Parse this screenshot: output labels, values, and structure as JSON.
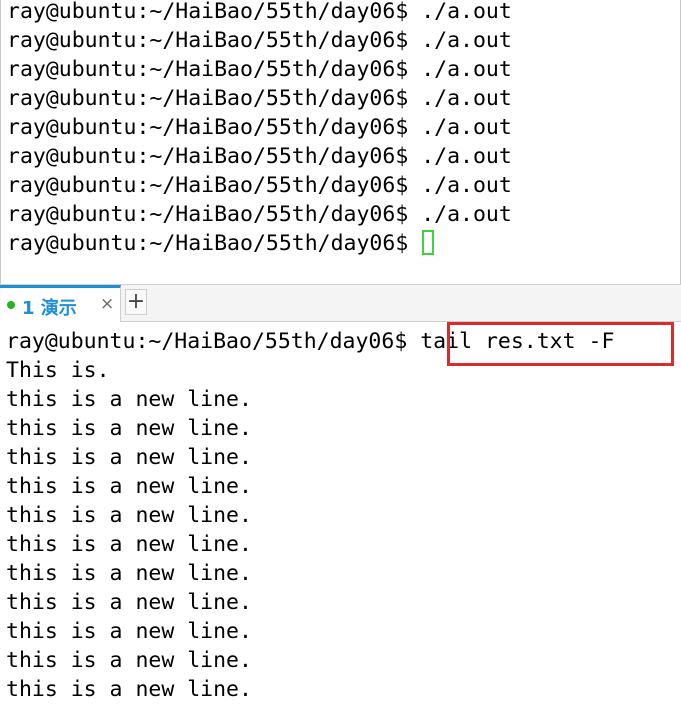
{
  "top_pane": {
    "lines": [
      "ray@ubuntu:~/HaiBao/55th/day06$ ./a.out",
      "ray@ubuntu:~/HaiBao/55th/day06$ ./a.out",
      "ray@ubuntu:~/HaiBao/55th/day06$ ./a.out",
      "ray@ubuntu:~/HaiBao/55th/day06$ ./a.out",
      "ray@ubuntu:~/HaiBao/55th/day06$ ./a.out",
      "ray@ubuntu:~/HaiBao/55th/day06$ ./a.out",
      "ray@ubuntu:~/HaiBao/55th/day06$ ./a.out",
      "ray@ubuntu:~/HaiBao/55th/day06$ ./a.out"
    ],
    "prompt": "ray@ubuntu:~/HaiBao/55th/day06$"
  },
  "tabbar": {
    "tab_label": "1 演示",
    "close_glyph": "×",
    "add_glyph": "+",
    "status_color": "#1fb81f",
    "accent_color": "#1f8fd6"
  },
  "bottom_pane": {
    "prompt": "ray@ubuntu:~/HaiBao/55th/day06$",
    "command": "tail res.txt -F",
    "highlight_color": "#d92c2c",
    "output": [
      "This is.",
      "this is a new line.",
      "this is a new line.",
      "this is a new line.",
      "this is a new line.",
      "this is a new line.",
      "this is a new line.",
      "this is a new line.",
      "this is a new line.",
      "this is a new line.",
      "this is a new line.",
      "this is a new line."
    ]
  }
}
